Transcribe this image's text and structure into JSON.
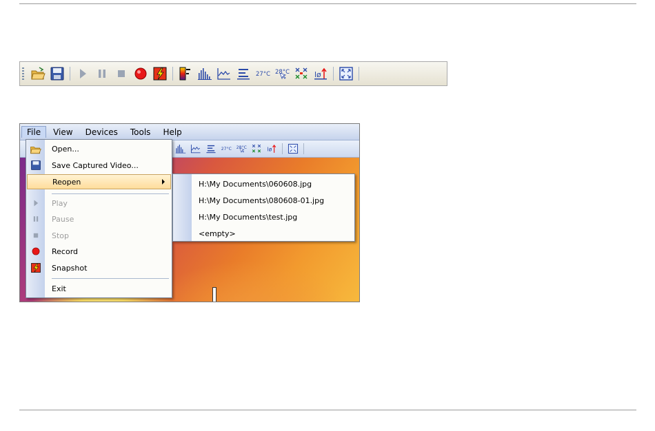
{
  "toolbar": {
    "buttons": [
      {
        "name": "open-folder-icon"
      },
      {
        "name": "save-icon"
      },
      {
        "name": "play-icon"
      },
      {
        "name": "pause-icon"
      },
      {
        "name": "stop-icon"
      },
      {
        "name": "record-icon"
      },
      {
        "name": "snapshot-icon"
      },
      {
        "name": "palette-icon"
      },
      {
        "name": "histogram-icon"
      },
      {
        "name": "line-profile-icon"
      },
      {
        "name": "isotherm-icon"
      },
      {
        "name": "temperature-range-icon"
      },
      {
        "name": "temperature-cursor-icon"
      },
      {
        "name": "crosshair-spots-icon"
      },
      {
        "name": "emissivity-icon"
      },
      {
        "name": "fullscreen-icon"
      }
    ],
    "colors": {
      "record": "#e81818",
      "snapshot": "#e83018",
      "blue": "#2a49a8"
    }
  },
  "app": {
    "menubar": [
      "File",
      "View",
      "Devices",
      "Tools",
      "Help"
    ],
    "file_menu": {
      "items": [
        {
          "label": "Open...",
          "icon": "open-folder-icon",
          "enabled": true
        },
        {
          "label": "Save Captured Video...",
          "icon": "save-icon",
          "enabled": true
        },
        {
          "label": "Reopen",
          "icon": "",
          "enabled": true,
          "submenu": true
        },
        {
          "label": "Play",
          "icon": "play-icon",
          "enabled": false
        },
        {
          "label": "Pause",
          "icon": "pause-icon",
          "enabled": false
        },
        {
          "label": "Stop",
          "icon": "stop-icon",
          "enabled": false
        },
        {
          "label": "Record",
          "icon": "record-icon",
          "enabled": true
        },
        {
          "label": "Snapshot",
          "icon": "snapshot-icon",
          "enabled": true
        },
        {
          "label": "Exit",
          "icon": "",
          "enabled": true
        }
      ]
    },
    "reopen_submenu": [
      "H:\\My Documents\\060608.jpg",
      "H:\\My Documents\\080608-01.jpg",
      "H:\\My Documents\\test.jpg",
      "<empty>"
    ]
  }
}
